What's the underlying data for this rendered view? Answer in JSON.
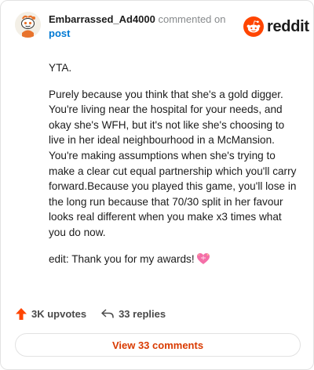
{
  "comment": {
    "username": "Embarrassed_Ad4000",
    "action_text": "commented on",
    "post_link": "post",
    "paragraphs": [
      "YTA.",
      "Purely because you think that she's a gold digger. You're living near the hospital for your needs, and okay she's WFH, but it's not like she's choosing to live in her ideal neighbourhood in a McMansion. You're making assumptions when she's trying to make a clear cut equal partnership which you'll carry forward.Because you played this game, you'll lose in the long run because that 70/30 split in her favour looks real different when you make x3 times what you do now.",
      "edit: Thank you for my awards!"
    ]
  },
  "brand": {
    "name": "reddit",
    "accent": "#ff4500"
  },
  "icons": {
    "heart": "sparkling-heart-icon",
    "upvote": "upvote-arrow-icon",
    "reply": "reply-arrow-icon",
    "avatar": "snoo-avatar-icon"
  },
  "stats": {
    "upvotes": "3K upvotes",
    "replies": "33 replies"
  },
  "view_comments_label": "View 33 comments",
  "colors": {
    "upvote": "#ff4500",
    "link": "#0079d3",
    "view_button_text": "#d93a00"
  }
}
